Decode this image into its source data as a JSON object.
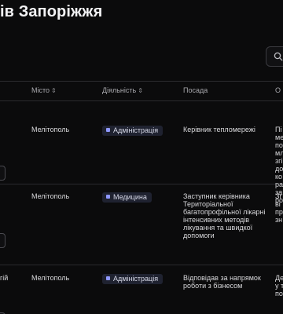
{
  "title": "ів Запоріжжя",
  "icons": {
    "search": "search-icon"
  },
  "table": {
    "headers": {
      "city": "Місто",
      "activity": "Діяльність",
      "position": "Посада",
      "description": "О"
    },
    "rows": [
      {
        "city": "Мелітополь",
        "activity": "Адміністрація",
        "position": "Керівник тепломережі",
        "description": "Пі\nме\nпо\nмл\nзгі\nдо\nко\nра\nза\nро"
      },
      {
        "city": "Мелітополь",
        "activity": "Медицина",
        "position": "Заступник керівника Територіальної багатопрофільної лікарні інтенсивних методів лікування та швидкої допомоги",
        "description": "Зг\nві\nпр\nзн"
      },
      {
        "name_fragment": "гій",
        "city": "Мелітополь",
        "activity": "Адміністрація",
        "position": "Відповідав за напрямок роботи з бізнесом",
        "description": "Де\nу т\nпо"
      }
    ]
  },
  "colors": {
    "background": "#0b0b0c",
    "badge_bg": "#1f2230",
    "badge_dot": "#8f98ff",
    "divider": "#2a2a2e"
  }
}
